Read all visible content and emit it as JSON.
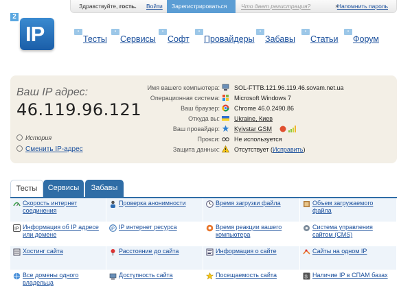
{
  "topbar": {
    "greeting": "Здравствуйте,",
    "guest": "гость.",
    "login": "Войти",
    "register": "Зарегистрироваться",
    "why_register": "Что дает регистрация?",
    "close": "×",
    "remind": "Напомнить пароль"
  },
  "logo": {
    "text": "IP",
    "badge": "2"
  },
  "nav": [
    {
      "label": "Тесты",
      "icon": "tests-icon"
    },
    {
      "label": "Сервисы",
      "icon": "services-icon"
    },
    {
      "label": "Софт",
      "icon": "soft-icon"
    },
    {
      "label": "Провайдеры",
      "icon": "providers-icon"
    },
    {
      "label": "Забавы",
      "icon": "fun-icon"
    },
    {
      "label": "Статьи",
      "icon": "articles-icon"
    },
    {
      "label": "Форум",
      "icon": "forum-icon"
    }
  ],
  "ip": {
    "caption": "Ваш IP адрес:",
    "value": "46.119.96.121",
    "history": "История",
    "change": "Сменить IP-адрес"
  },
  "info": [
    {
      "key": "Имя вашего компьютера:",
      "value": "SOL-FTTB.121.96.119.46.sovam.net.ua",
      "icon": "computer-icon"
    },
    {
      "key": "Операционная система:",
      "value": "Microsoft Windows 7",
      "icon": "windows-icon"
    },
    {
      "key": "Ваш браузер:",
      "value": "Chrome 46.0.2490.86",
      "icon": "chrome-icon"
    },
    {
      "key": "Откуда вы:",
      "value": "Ukraine, Киев",
      "icon": "flag-icon"
    },
    {
      "key": "Ваш провайдер:",
      "value": "Kyivstar GSM",
      "icon": "star-icon"
    },
    {
      "key": "Прокси:",
      "value": "Не используется",
      "icon": "glasses-icon"
    },
    {
      "key": "Защита данных:",
      "value": "Отсутствует (",
      "link": "Исправить",
      "close": ")",
      "icon": "warning-icon"
    }
  ],
  "tabs": [
    {
      "label": "Тесты",
      "active": true
    },
    {
      "label": "Сервисы",
      "active": false
    },
    {
      "label": "Забавы",
      "active": false
    }
  ],
  "services": [
    {
      "label": "Скорость интернет соединения",
      "icon": "speed-icon"
    },
    {
      "label": "Проверка анонимности",
      "icon": "anonymity-icon"
    },
    {
      "label": "Время загрузки файла",
      "icon": "clock-icon"
    },
    {
      "label": "Объем загружаемого файла",
      "icon": "file-size-icon"
    },
    {
      "label": "Информация об IP адресе или домене",
      "icon": "ip-info-icon"
    },
    {
      "label": "IP интернет ресурса",
      "icon": "ip-resource-icon"
    },
    {
      "label": "Время реакции вашего компьютера",
      "icon": "reaction-icon"
    },
    {
      "label": "Система управления сайтом (CMS)",
      "icon": "cms-icon"
    },
    {
      "label": "Хостинг сайта",
      "icon": "hosting-icon"
    },
    {
      "label": "Расстояние до сайта",
      "icon": "pin-icon"
    },
    {
      "label": "Информация о сайте",
      "icon": "site-info-icon"
    },
    {
      "label": "Сайты на одном IP",
      "icon": "same-ip-icon"
    },
    {
      "label": "Все домены одного владельца",
      "icon": "domains-icon"
    },
    {
      "label": "Доступность сайта",
      "icon": "availability-icon"
    },
    {
      "label": "Посещаемость сайта",
      "icon": "traffic-icon"
    },
    {
      "label": "Наличие IP в СПАМ базах",
      "icon": "spam-icon"
    }
  ],
  "colors": {
    "accent": "#2f6da6",
    "link": "#1a4f9c",
    "box": "#f3efe6",
    "cell": "#eef4fa"
  }
}
